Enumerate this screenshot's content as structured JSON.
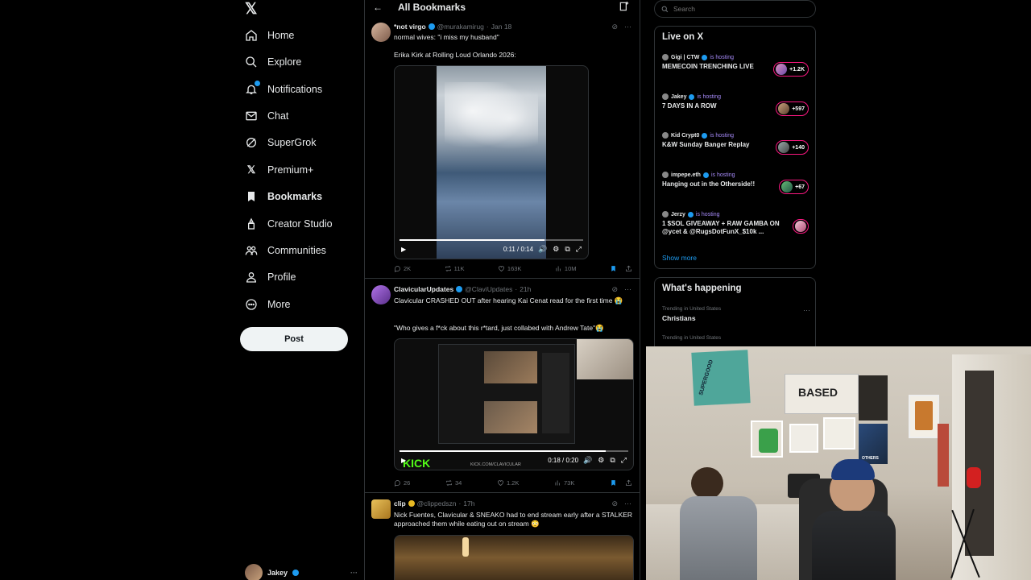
{
  "nav": {
    "items": [
      {
        "label": "Home",
        "icon": "home-icon"
      },
      {
        "label": "Explore",
        "icon": "search-icon"
      },
      {
        "label": "Notifications",
        "icon": "bell-icon"
      },
      {
        "label": "Chat",
        "icon": "mail-icon"
      },
      {
        "label": "SuperGrok",
        "icon": "grok-icon"
      },
      {
        "label": "Premium+",
        "icon": "x-icon"
      },
      {
        "label": "Bookmarks",
        "icon": "bookmark-icon"
      },
      {
        "label": "Creator Studio",
        "icon": "creator-icon"
      },
      {
        "label": "Communities",
        "icon": "communities-icon"
      },
      {
        "label": "Profile",
        "icon": "profile-icon"
      },
      {
        "label": "More",
        "icon": "more-icon"
      }
    ],
    "post_label": "Post",
    "account_name": "Jakey"
  },
  "header": {
    "title": "All Bookmarks"
  },
  "tweets": [
    {
      "name": "*not virgo",
      "handle": "@murakamirug",
      "time": "Jan 18",
      "text1": "normal wives: \"i miss my husband\"",
      "text2": "Erika Kirk at Rolling Loud Orlando 2026:",
      "video_time": "0:11 / 0:14",
      "video_progress": 0.79,
      "replies": "2K",
      "reposts": "11K",
      "likes": "163K",
      "views": "10M"
    },
    {
      "name": "ClavicularUpdates",
      "handle": "@ClaviUpdates",
      "time": "21h",
      "text1": "Clavicular CRASHED OUT after hearing Kai Cenat read for the first time 😭",
      "text2": "\"Who gives a f*ck about this r*tard, just collabed with Andrew Tate\"😭",
      "video_time": "0:18 / 0:20",
      "video_progress": 0.9,
      "video_kick": "KICK",
      "video_kick_url": "KICK.COM/CLAVICULAR",
      "replies": "26",
      "reposts": "34",
      "likes": "1.2K",
      "views": "73K"
    },
    {
      "name": "clip",
      "handle": "@clippedszn",
      "time": "17h",
      "text1": "Nick Fuentes, Clavicular & SNEAKO had to end stream early after a STALKER approached them while eating out on stream 😳"
    }
  ],
  "search": {
    "placeholder": "Search"
  },
  "live": {
    "title": "Live on X",
    "hosting_label": "is hosting",
    "items": [
      {
        "host": "Gigi | CTW",
        "title": "MEMECOIN TRENCHING LIVE",
        "count": "+1.2K"
      },
      {
        "host": "Jakey",
        "title": "7 DAYS IN A ROW",
        "count": "+597"
      },
      {
        "host": "Kid Crypt0",
        "title": "K&W Sunday Banger Replay",
        "count": "+140"
      },
      {
        "host": "impepe.eth",
        "title": "Hanging out in the Otherside!!",
        "count": "+67"
      },
      {
        "host": "Jerzy",
        "title": "1 $SOL GIVEAWAY + RAW GAMBA ON @ycet & @RugsDotFunX_$10k ...",
        "count": ""
      }
    ],
    "show_more": "Show more"
  },
  "happening": {
    "title": "What's happening",
    "trends": [
      {
        "meta": "Trending in United States",
        "name": "Christians"
      },
      {
        "meta": "Trending in United States",
        "name": ""
      }
    ]
  },
  "webcam": {
    "sign_based": "BASED",
    "poster_left": "SUPERGOOD",
    "poster_right": "OTHERS"
  },
  "colors": {
    "accent": "#1d9bf0",
    "live": "#f91880",
    "bg": "#000000",
    "border": "#2f3336"
  }
}
